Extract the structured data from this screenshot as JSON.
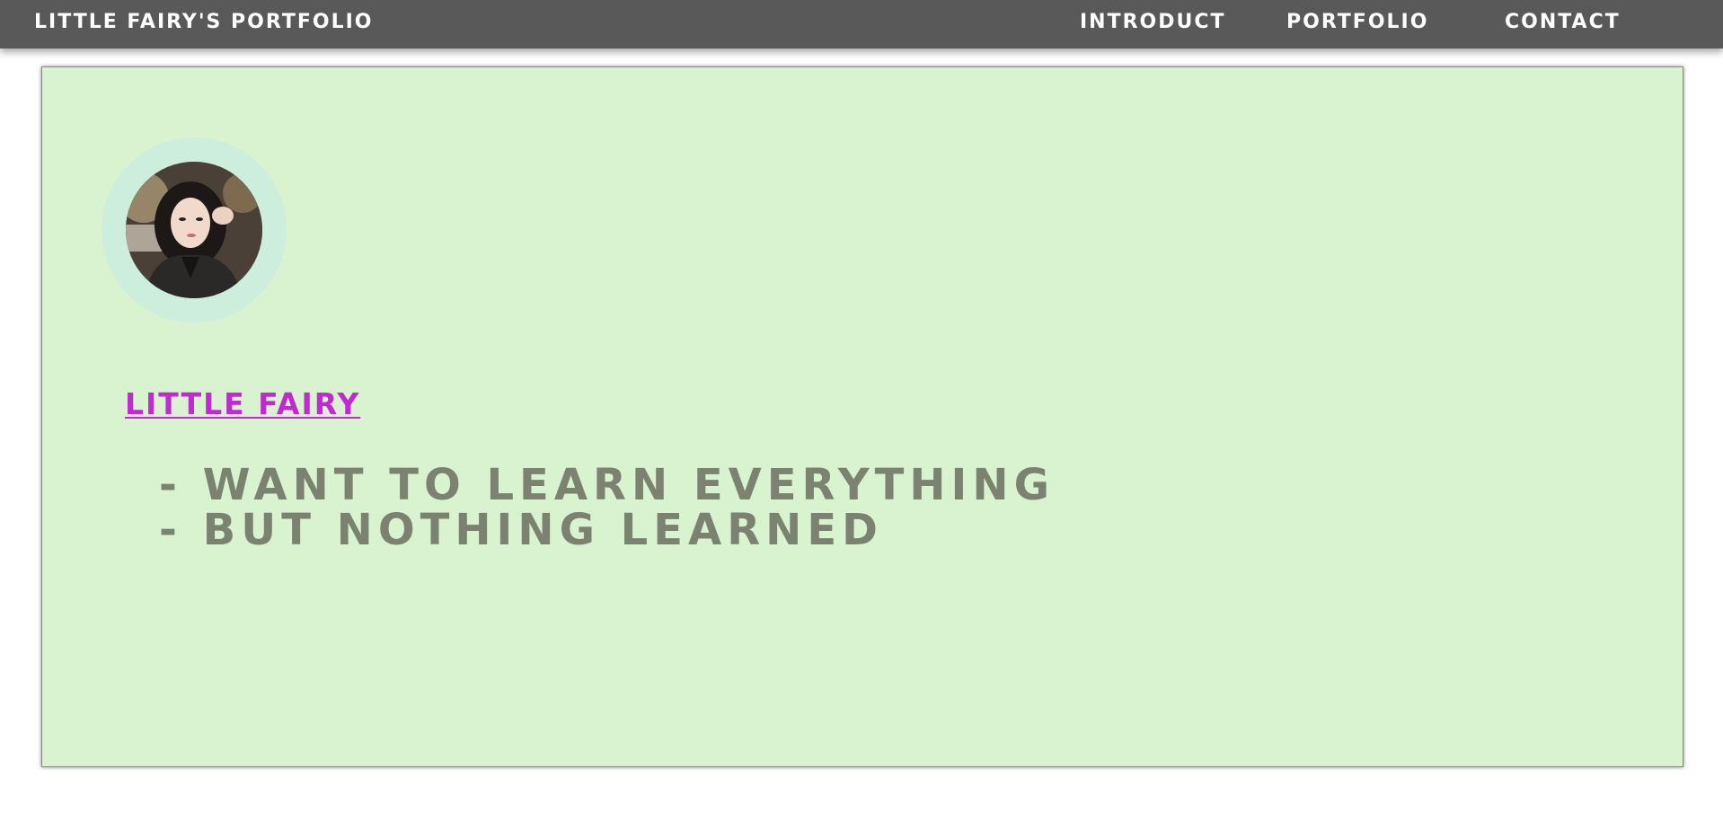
{
  "header": {
    "brand": "LITTLE FAIRY'S PORTFOLIO",
    "nav": [
      {
        "label": "INTRODUCT"
      },
      {
        "label": "PORTFOLIO"
      },
      {
        "label": "CONTACT"
      }
    ]
  },
  "profile": {
    "name": "LITTLE FAIRY",
    "tagline": [
      "- WANT TO LEARN EVERYTHING",
      "- BUT NOTHING LEARNED"
    ]
  },
  "colors": {
    "header_bg": "#595959",
    "card_bg": "#d9f2d0",
    "avatar_ring": "#cdeedd",
    "name_link": "#c02bd0",
    "tagline_text": "#7b8270"
  }
}
